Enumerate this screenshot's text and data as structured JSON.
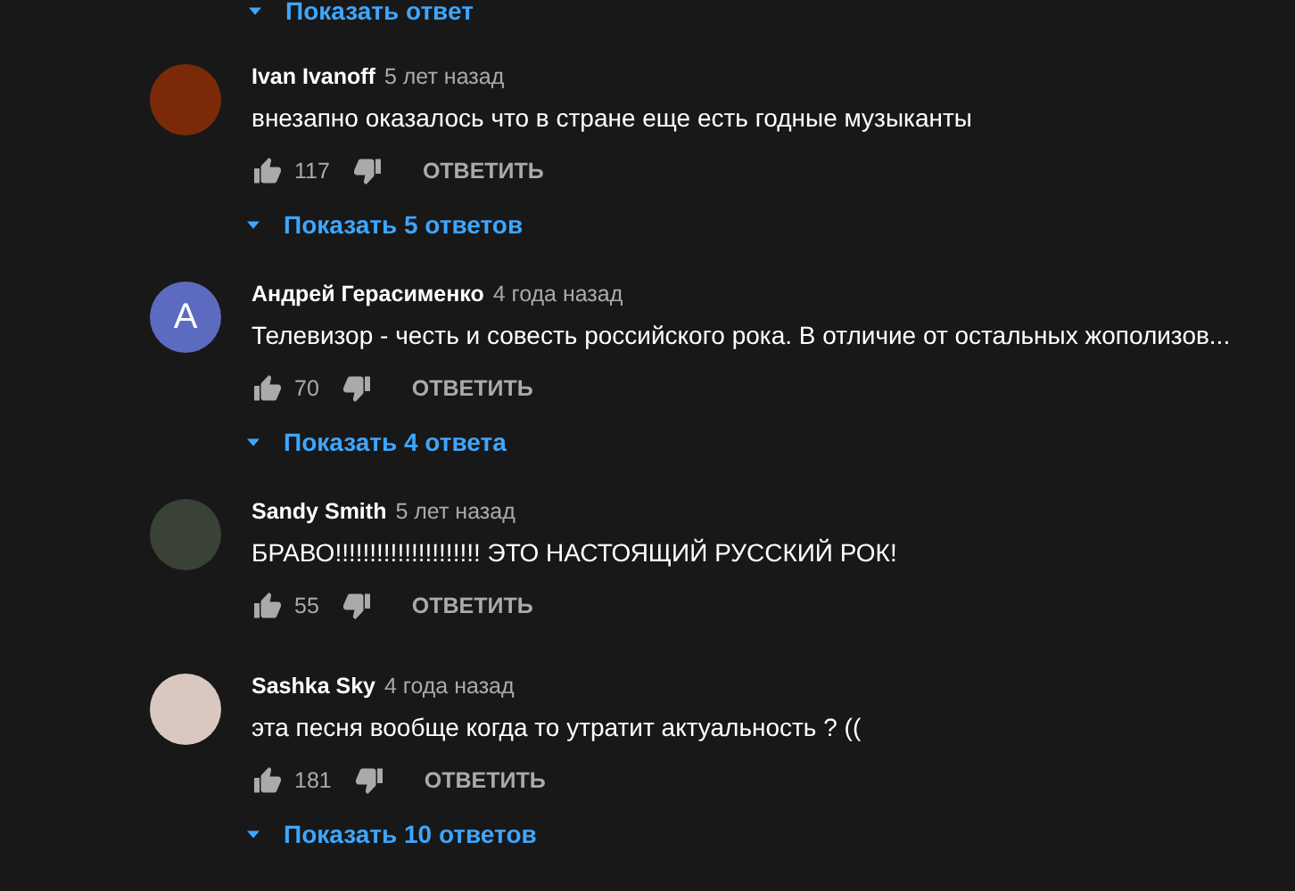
{
  "top_replies_link": {
    "label": "Показать ответ"
  },
  "comments": [
    {
      "author": "Ivan Ivanoff",
      "time": "5 лет назад",
      "avatar": {
        "kind": "photo",
        "color": "#7a2a08"
      },
      "text": "внезапно оказалось что в стране еще есть годные музыканты",
      "likes": "117",
      "reply_label": "ОТВЕТИТЬ",
      "replies_link": "Показать 5 ответов"
    },
    {
      "author": "Андрей Герасименко",
      "time": "4 года назад",
      "avatar": {
        "kind": "letter",
        "letter": "A",
        "color": "#5c6bc0"
      },
      "text": "Телевизор - честь и совесть российского рока. В отличие от остальных жополизов...",
      "likes": "70",
      "reply_label": "ОТВЕТИТЬ",
      "replies_link": "Показать 4 ответа"
    },
    {
      "author": "Sandy Smith",
      "time": "5 лет назад",
      "avatar": {
        "kind": "photo",
        "color": "#3a4238"
      },
      "text": "БРАВО!!!!!!!!!!!!!!!!!!!!! ЭТО НАСТОЯЩИЙ РУССКИЙ РОК!",
      "likes": "55",
      "reply_label": "ОТВЕТИТЬ"
    },
    {
      "author": "Sashka Sky",
      "time": "4 года назад",
      "avatar": {
        "kind": "photo",
        "color": "#d8c8c0"
      },
      "text": "эта песня вообще когда то утратит актуальность ? ((",
      "likes": "181",
      "reply_label": "ОТВЕТИТЬ",
      "replies_link": "Показать 10 ответов"
    }
  ]
}
